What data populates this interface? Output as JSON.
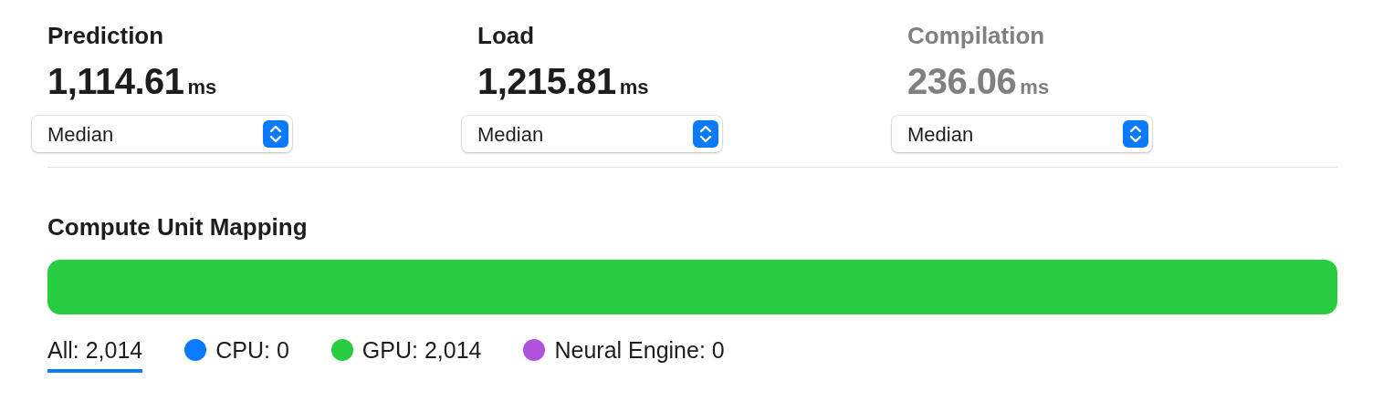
{
  "metrics": [
    {
      "title": "Prediction",
      "value": "1,114.61",
      "unit": "ms",
      "statistic": "Median",
      "dimmed": false
    },
    {
      "title": "Load",
      "value": "1,215.81",
      "unit": "ms",
      "statistic": "Median",
      "dimmed": false
    },
    {
      "title": "Compilation",
      "value": "236.06",
      "unit": "ms",
      "statistic": "Median",
      "dimmed": true
    }
  ],
  "mapping": {
    "title": "Compute Unit Mapping",
    "legend": [
      {
        "kind": "all",
        "label": "All: 2,014",
        "selected": true
      },
      {
        "kind": "unit",
        "label": "CPU: 0",
        "color": "#0a7aff",
        "level": 0,
        "selected": false
      },
      {
        "kind": "unit",
        "label": "GPU: 2,014",
        "color": "#28cd41",
        "level": 1,
        "selected": false
      },
      {
        "kind": "unit",
        "label": "Neural Engine: 0",
        "color": "#af52de",
        "level": 0,
        "selected": false
      }
    ]
  }
}
